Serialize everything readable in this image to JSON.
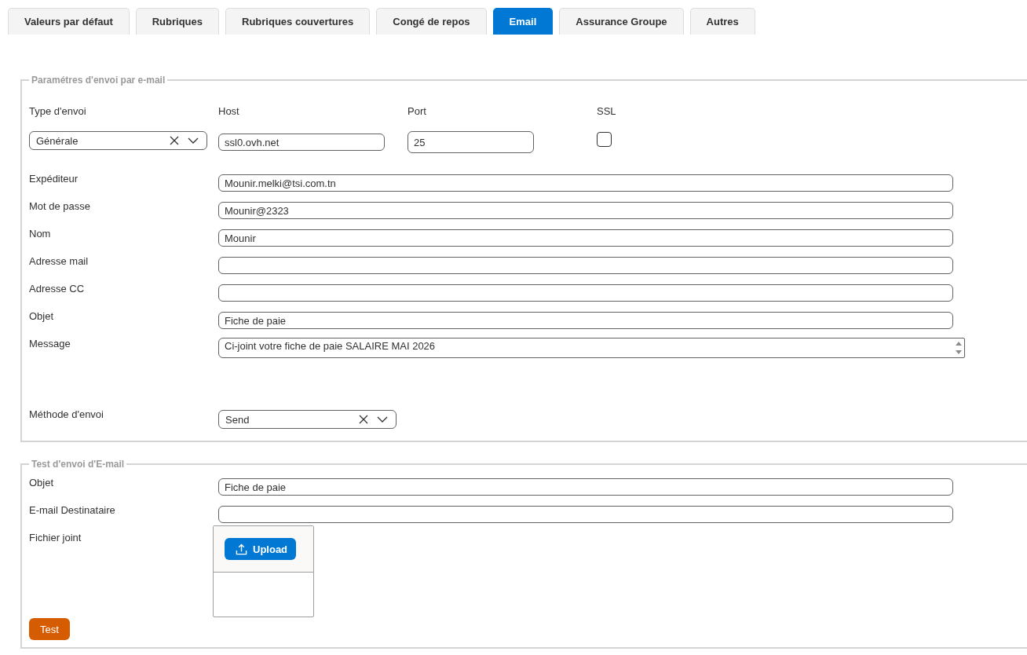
{
  "tabs": [
    {
      "label": "Valeurs par défaut",
      "selected": false
    },
    {
      "label": "Rubriques",
      "selected": false
    },
    {
      "label": "Rubriques couvertures",
      "selected": false
    },
    {
      "label": "Congé de repos",
      "selected": false
    },
    {
      "label": "Email",
      "selected": true
    },
    {
      "label": "Assurance Groupe",
      "selected": false
    },
    {
      "label": "Autres",
      "selected": false
    }
  ],
  "email_settings": {
    "legend": "Paramétres d'envoi par e-mail",
    "top_fields": [
      {
        "kind": "select",
        "label": "Type d'envoi",
        "value": "Générale"
      },
      {
        "kind": "text",
        "label": "Host",
        "value": "ssl0.ovh.net"
      },
      {
        "kind": "text",
        "label": "Port",
        "value": "25"
      },
      {
        "kind": "checkbox",
        "label": "SSL",
        "checked": false
      }
    ],
    "fields": [
      {
        "kind": "text",
        "label": "Expéditeur",
        "value": "Mounir.melki@tsi.com.tn"
      },
      {
        "kind": "text",
        "label": "Mot de passe",
        "value": "Mounir@2323"
      },
      {
        "kind": "text",
        "label": "Nom",
        "value": "Mounir"
      },
      {
        "kind": "text",
        "label": "Adresse mail"
      },
      {
        "kind": "text",
        "label": "Adresse CC"
      },
      {
        "kind": "text",
        "label": "Objet",
        "value": "Fiche de paie"
      },
      {
        "kind": "textarea",
        "label": "Message",
        "value": "Ci-joint votre fiche de paie SALAIRE MAI 2026"
      },
      {
        "kind": "select",
        "label": "Méthode d'envoi",
        "value": "Send"
      }
    ]
  },
  "test_email": {
    "legend": "Test d'envoi d'E-mail",
    "fields": [
      {
        "kind": "text",
        "label": "Objet",
        "value": "Fiche de paie"
      },
      {
        "kind": "text",
        "label": "E-mail Destinataire"
      },
      {
        "kind": "upload",
        "label": "Fichier joint",
        "button": "Upload"
      }
    ],
    "button": "Test"
  }
}
